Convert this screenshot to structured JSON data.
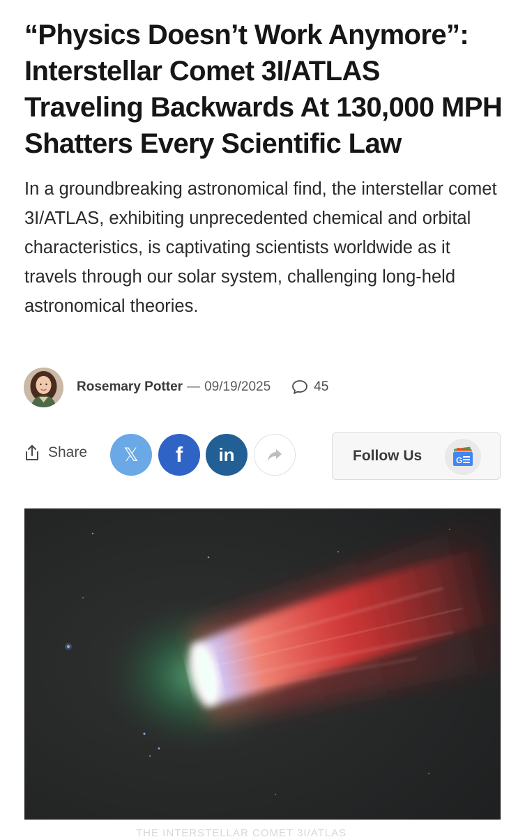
{
  "article": {
    "headline": "“Physics Doesn’t Work Anymore”: Interstellar Comet 3I/ATLAS Traveling Backwards At 130,000 MPH Shatters Every Scientific Law",
    "excerpt": "In a groundbreaking astronomical find, the interstellar comet 3I/ATLAS, exhibiting unprecedented chemical and orbital characteristics, is captivating scientists worldwide as it travels through our solar system, challenging long-held astronomical theories."
  },
  "byline": {
    "author": "Rosemary Potter",
    "separator": "—",
    "date": "09/19/2025",
    "comment_count": "45"
  },
  "share": {
    "label": "Share",
    "x_glyph": "𝕏",
    "facebook_glyph": "f",
    "linkedin_glyph": "in",
    "follow_label": "Follow Us"
  },
  "hero_image": {
    "subject": "comet-illustration"
  },
  "footer_peek": {
    "text": "THE INTERSTELLAR COMET 3I/ATLAS"
  },
  "colors": {
    "x_blue": "#6aa8e6",
    "facebook_blue": "#2f63c6",
    "linkedin_blue": "#225f94",
    "hero_background": "#262728"
  }
}
